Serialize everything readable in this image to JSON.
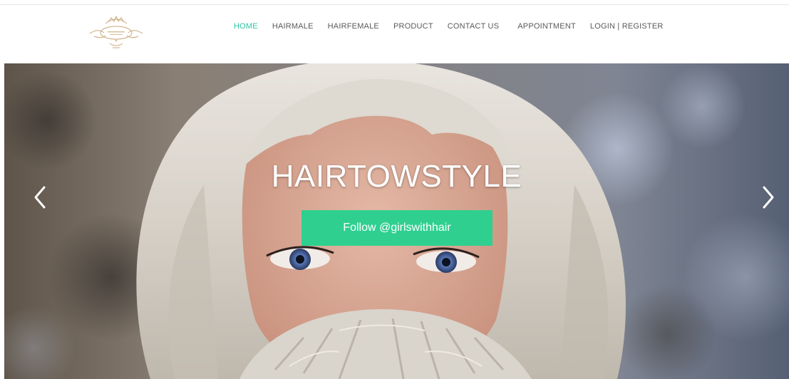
{
  "header": {
    "logo_icon": "salon-crest-logo",
    "nav": [
      {
        "label": "HOME",
        "active": true
      },
      {
        "label": "HAIRMALE",
        "active": false
      },
      {
        "label": "HAIRFEMALE",
        "active": false
      },
      {
        "label": "PRODUCT",
        "active": false
      },
      {
        "label": "CONTACT US",
        "active": false
      },
      {
        "label": "APPOINTMENT",
        "active": false
      },
      {
        "label": "LOGIN | REGISTER",
        "active": false
      }
    ],
    "active_color": "#2ec4a6",
    "nav_color": "#5a5a5a"
  },
  "hero": {
    "title": "HAIRTOWSTYLE",
    "cta_label": "Follow @girlswithhair",
    "cta_color": "#2fd08f",
    "prev_icon": "chevron-left-icon",
    "next_icon": "chevron-right-icon"
  }
}
